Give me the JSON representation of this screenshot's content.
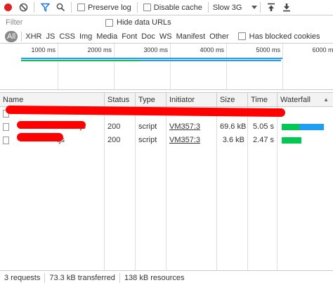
{
  "toolbar": {
    "preserve_log_label": "Preserve log",
    "disable_cache_label": "Disable cache",
    "throttle_value": "Slow 3G",
    "throttle_options": [
      "Slow 3G"
    ]
  },
  "filter": {
    "placeholder": "Filter",
    "hide_data_urls_label": "Hide data URLs"
  },
  "type_filters": [
    "All",
    "XHR",
    "JS",
    "CSS",
    "Img",
    "Media",
    "Font",
    "Doc",
    "WS",
    "Manifest",
    "Other"
  ],
  "has_blocked_cookies_label": "Has blocked cookies",
  "overview": {
    "ticks": [
      "1000 ms",
      "2000 ms",
      "3000 ms",
      "4000 ms",
      "5000 ms",
      "6000 ms"
    ]
  },
  "table": {
    "columns": [
      "Name",
      "Status",
      "Type",
      "Initiator",
      "Size",
      "Time",
      "Waterfall"
    ],
    "rows": [
      {
        "name": "",
        "status": "",
        "type": "",
        "initiator": "",
        "size": "",
        "time": "",
        "wf_start": 0,
        "wf_wait": 0,
        "wf_recv": 0
      },
      {
        "name": ".js",
        "status": "200",
        "type": "script",
        "initiator": "VM357:3",
        "size": "69.6 kB",
        "time": "5.05 s",
        "wf_start": 0.03,
        "wf_wait": 0.4,
        "wf_recv": 0.57
      },
      {
        "name": ".js",
        "status": "200",
        "type": "script",
        "initiator": "VM357:3",
        "size": "3.6 kB",
        "time": "2.47 s",
        "wf_start": 0.03,
        "wf_wait": 0.45,
        "wf_recv": 0.0
      }
    ]
  },
  "status_bar": {
    "requests": "3 requests",
    "transferred": "73.3 kB transferred",
    "resources": "138 kB resources"
  },
  "colors": {
    "record": "#e02020",
    "wait": "#00c853",
    "receive": "#1e9ff2",
    "redaction": "#ff0000",
    "active_filter": "#888888"
  }
}
